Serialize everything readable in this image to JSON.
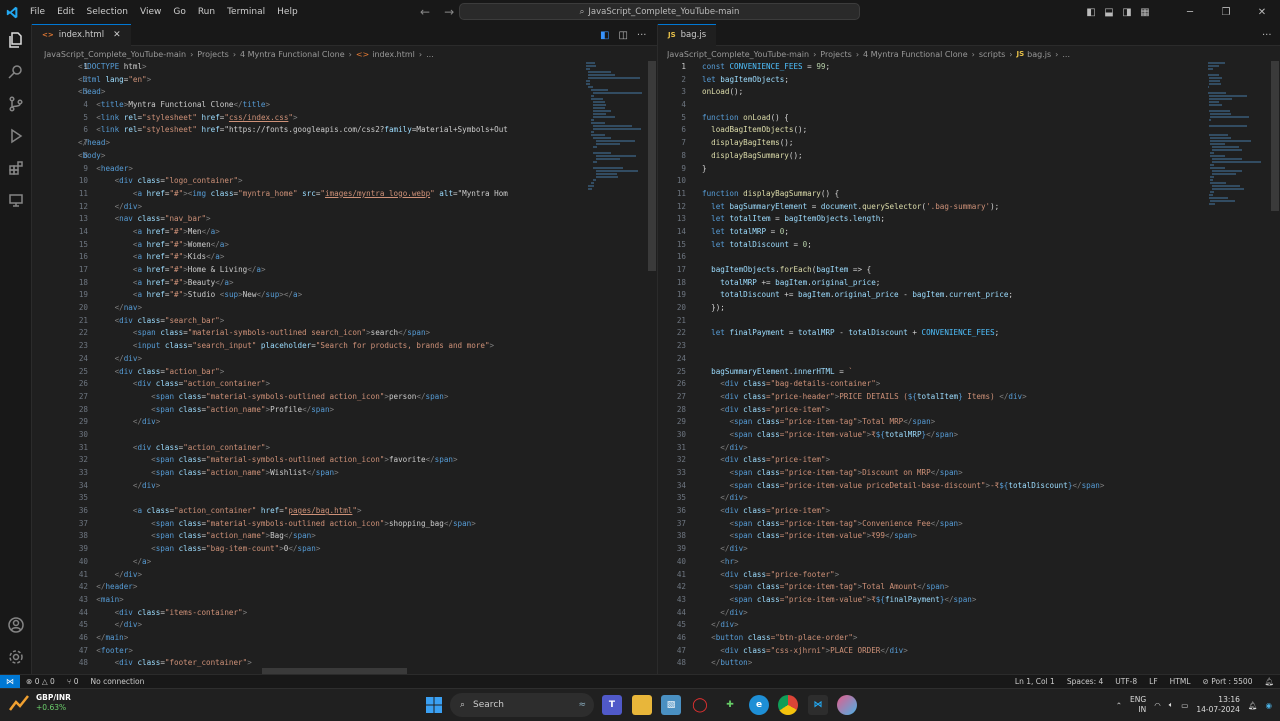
{
  "title_bar": {
    "menu": [
      "File",
      "Edit",
      "Selection",
      "View",
      "Go",
      "Run",
      "Terminal",
      "Help"
    ],
    "search": "JavaScript_Complete_YouTube-main"
  },
  "left_editor": {
    "tab": "index.html",
    "breadcrumb": [
      "JavaScript_Complete_YouTube-main",
      "Projects",
      "4 Myntra Functional Clone",
      "index.html",
      "..."
    ],
    "line_numbers": [
      "1",
      "2",
      "3",
      "4",
      "5",
      "6",
      "7",
      "8",
      "9",
      "10",
      "11",
      "12",
      "13",
      "14",
      "15",
      "16",
      "17",
      "18",
      "19",
      "20",
      "21",
      "22",
      "23",
      "24",
      "25",
      "26",
      "27",
      "28",
      "29",
      "30",
      "31",
      "32",
      "33",
      "34",
      "35",
      "36",
      "37",
      "38",
      "39",
      "40",
      "41",
      "42",
      "43",
      "44",
      "45",
      "46",
      "47",
      "48"
    ],
    "lines": [
      "<!DOCTYPE html>",
      "<html lang=\"en\">",
      "<head>",
      "    <title>Myntra Functional Clone</title>",
      "    <link rel=\"stylesheet\" href=\"css/index.css\">",
      "    <link rel=\"stylesheet\" href=\"https://fonts.googleapis.com/css2?family=Material+Symbols+Out",
      "</head>",
      "<body>",
      "    <header>",
      "        <div class=\"logo_container\">",
      "            <a href=\"#\"><img class=\"myntra_home\" src=\"images/myntra_logo.webp\" alt=\"Myntra Hom",
      "        </div>",
      "        <nav class=\"nav_bar\">",
      "            <a href=\"#\">Men</a>",
      "            <a href=\"#\">Women</a>",
      "            <a href=\"#\">Kids</a>",
      "            <a href=\"#\">Home & Living</a>",
      "            <a href=\"#\">Beauty</a>",
      "            <a href=\"#\">Studio <sup>New</sup></a>",
      "        </nav>",
      "        <div class=\"search_bar\">",
      "            <span class=\"material-symbols-outlined search_icon\">search</span>",
      "            <input class=\"search_input\" placeholder=\"Search for products, brands and more\">",
      "        </div>",
      "        <div class=\"action_bar\">",
      "            <div class=\"action_container\">",
      "                <span class=\"material-symbols-outlined action_icon\">person</span>",
      "                <span class=\"action_name\">Profile</span>",
      "            </div>",
      "",
      "            <div class=\"action_container\">",
      "                <span class=\"material-symbols-outlined action_icon\">favorite</span>",
      "                <span class=\"action_name\">Wishlist</span>",
      "            </div>",
      "",
      "            <a class=\"action_container\" href=\"pages/bag.html\">",
      "                <span class=\"material-symbols-outlined action_icon\">shopping_bag</span>",
      "                <span class=\"action_name\">Bag</span>",
      "                <span class=\"bag-item-count\">0</span>",
      "            </a>",
      "        </div>",
      "    </header>",
      "    <main>",
      "        <div class=\"items-container\">",
      "        </div>",
      "    </main>",
      "    <footer>",
      "        <div class=\"footer_container\">"
    ]
  },
  "right_editor": {
    "tab": "bag.js",
    "breadcrumb": [
      "JavaScript_Complete_YouTube-main",
      "Projects",
      "4 Myntra Functional Clone",
      "scripts",
      "bag.js",
      "..."
    ],
    "line_numbers": [
      "1",
      "2",
      "3",
      "4",
      "5",
      "6",
      "7",
      "8",
      "9",
      "10",
      "11",
      "12",
      "13",
      "14",
      "15",
      "16",
      "17",
      "18",
      "19",
      "20",
      "21",
      "22",
      "23",
      "24",
      "25",
      "26",
      "27",
      "28",
      "29",
      "30",
      "31",
      "32",
      "33",
      "34",
      "35",
      "36",
      "37",
      "38",
      "39",
      "40",
      "41",
      "42",
      "43",
      "44",
      "45",
      "46",
      "47",
      "48"
    ],
    "lines": [
      "const CONVENIENCE_FEES = 99;",
      "let bagItemObjects;",
      "onLoad();",
      "",
      "function onLoad() {",
      "  loadBagItemObjects();",
      "  displayBagItems();",
      "  displayBagSummary();",
      "}",
      "",
      "function displayBagSummary() {",
      "  let bagSummaryElement = document.querySelector('.bag-summary');",
      "  let totalItem = bagItemObjects.length;",
      "  let totalMRP = 0;",
      "  let totalDiscount = 0;",
      "",
      "  bagItemObjects.forEach(bagItem => {",
      "    totalMRP += bagItem.original_price;",
      "    totalDiscount += bagItem.original_price - bagItem.current_price;",
      "  });",
      "",
      "  let finalPayment = totalMRP - totalDiscount + CONVENIENCE_FEES;",
      "",
      "",
      "  bagSummaryElement.innerHTML = `",
      "    <div class=\"bag-details-container\">",
      "    <div class=\"price-header\">PRICE DETAILS (${totalItem} Items) </div>",
      "    <div class=\"price-item\">",
      "      <span class=\"price-item-tag\">Total MRP</span>",
      "      <span class=\"price-item-value\">₹${totalMRP}</span>",
      "    </div>",
      "    <div class=\"price-item\">",
      "      <span class=\"price-item-tag\">Discount on MRP</span>",
      "      <span class=\"price-item-value priceDetail-base-discount\">-₹${totalDiscount}</span>",
      "    </div>",
      "    <div class=\"price-item\">",
      "      <span class=\"price-item-tag\">Convenience Fee</span>",
      "      <span class=\"price-item-value\">₹99</span>",
      "    </div>",
      "    <hr>",
      "    <div class=\"price-footer\">",
      "      <span class=\"price-item-tag\">Total Amount</span>",
      "      <span class=\"price-item-value\">₹${finalPayment}</span>",
      "    </div>",
      "  </div>",
      "  <button class=\"btn-place-order\">",
      "    <div class=\"css-xjhrni\">PLACE ORDER</div>",
      "  </button>"
    ]
  },
  "status_bar": {
    "errors": "0",
    "warnings": "0",
    "ports_count": "0",
    "connection": "No connection",
    "cursor": "Ln 1, Col 1",
    "spaces": "Spaces: 4",
    "encoding": "UTF-8",
    "eol": "LF",
    "language": "HTML",
    "port": "Port : 5500"
  },
  "taskbar": {
    "ticker": "GBP/INR",
    "ticker_change": "+0.63%",
    "search": "Search",
    "lang": "ENG",
    "lang_region": "IN",
    "time": "13:16",
    "date": "14-07-2024"
  }
}
